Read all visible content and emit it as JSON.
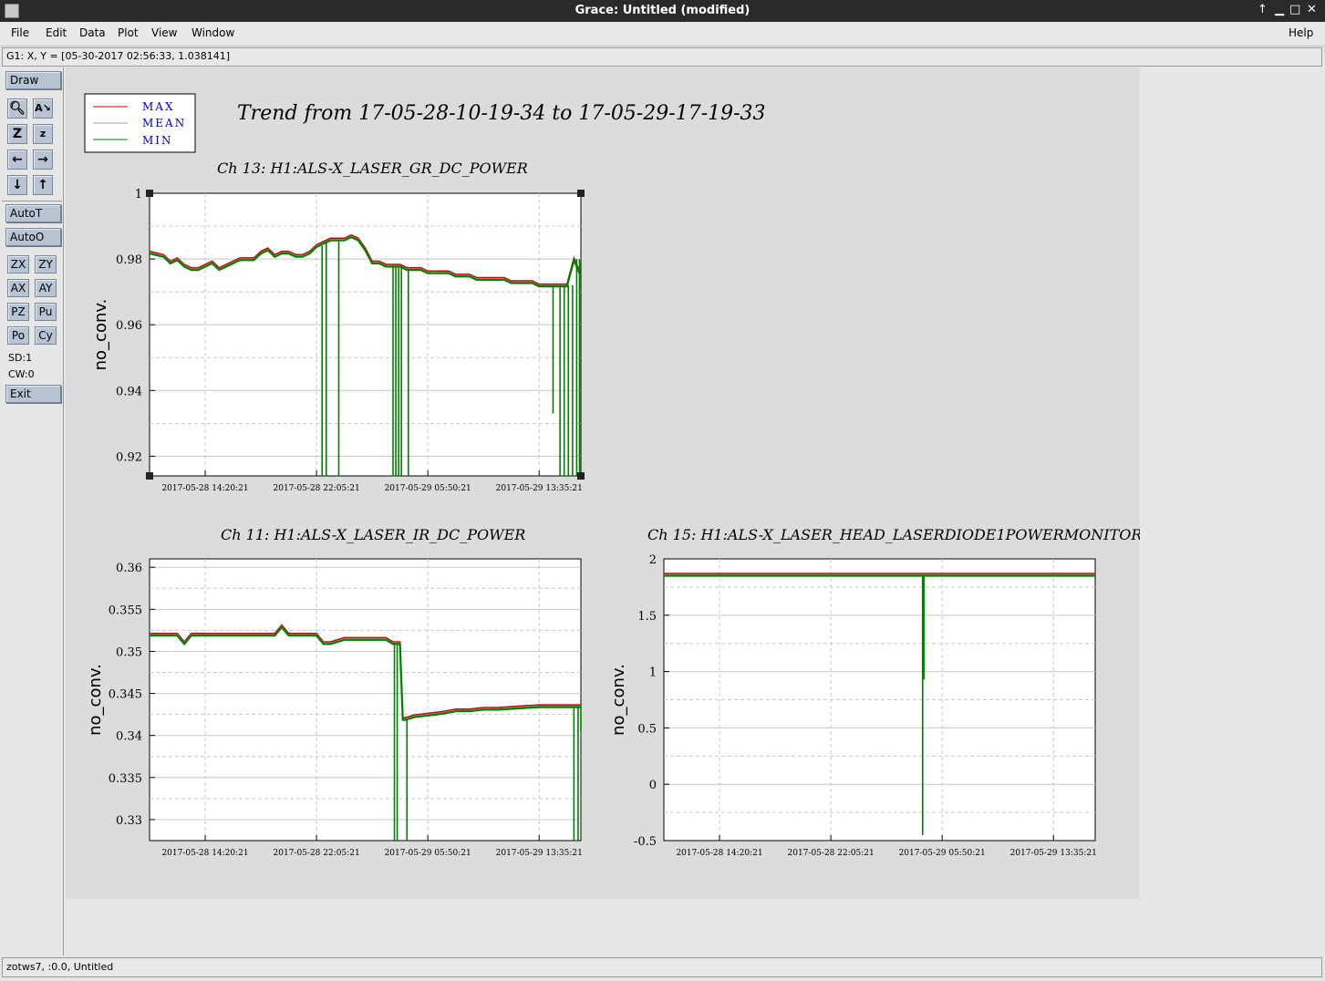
{
  "window": {
    "title": "Grace: Untitled (modified)",
    "controls": [
      "↑",
      "▁",
      "□",
      "✕"
    ]
  },
  "menu": {
    "file": "File",
    "edit": "Edit",
    "data": "Data",
    "plot": "Plot",
    "view": "View",
    "window": "Window",
    "help": "Help"
  },
  "locator": "G1: X, Y = [05-30-2017 02:56:33, 1.038141]",
  "toolbar": {
    "draw": "Draw",
    "autot": "AutoT",
    "autoo": "AutoO",
    "zx": "ZX",
    "zy": "ZY",
    "ax": "AX",
    "ay": "AY",
    "pz": "PZ",
    "pu": "Pu",
    "po": "Po",
    "cy": "Cy",
    "sd": "SD:1",
    "cw": "CW:0",
    "exit": "Exit",
    "icons": [
      "zoom-icon",
      "autoscale-icon",
      "zoom-in-icon",
      "zoom-out-icon",
      "arrow-left-icon",
      "arrow-right-icon",
      "arrow-down-icon",
      "arrow-up-icon"
    ]
  },
  "status": "zotws7, :0.0, Untitled",
  "canvas": {
    "main_title": "Trend from 17-05-28-10-19-34 to 17-05-29-17-19-33",
    "legend": [
      {
        "label": "MAX",
        "color": "#d00000"
      },
      {
        "label": "MEAN",
        "color": "#a0a0a0"
      },
      {
        "label": "MIN",
        "color": "#008000"
      }
    ]
  },
  "chart_data": [
    {
      "type": "line",
      "title": "Ch 13: H1:ALS-X_LASER_GR_DC_POWER",
      "ylabel": "no_conv.",
      "ylim": [
        0.914,
        1.0
      ],
      "yticks": [
        0.92,
        0.94,
        0.96,
        0.98,
        1
      ],
      "ytick_labels": [
        "0.92",
        "0.94",
        "0.96",
        "0.98",
        "1"
      ],
      "xlim": [
        0,
        31
      ],
      "xticks": [
        4,
        12,
        20,
        28
      ],
      "xtick_labels": [
        "2017-05-28 14:20:21",
        "2017-05-28 22:05:21",
        "2017-05-29 05:50:21",
        "2017-05-29 13:35:21"
      ],
      "series_x": [
        0,
        1,
        1.5,
        2,
        2.5,
        3,
        3.5,
        4,
        4.5,
        5,
        5.5,
        6,
        6.5,
        7,
        7.5,
        8,
        8.5,
        9,
        9.5,
        10,
        10.5,
        11,
        11.5,
        12,
        12.5,
        13,
        13.5,
        14,
        14.5,
        15,
        15.5,
        16,
        16.5,
        17,
        17.5,
        18,
        18.5,
        19,
        19.5,
        20,
        20.5,
        21,
        21.5,
        22,
        22.5,
        23,
        23.5,
        24,
        24.5,
        25,
        25.5,
        26,
        26.5,
        27,
        27.5,
        28,
        28.5,
        29,
        29.5,
        30,
        30.5,
        31
      ],
      "series_y": [
        0.982,
        0.981,
        0.979,
        0.98,
        0.978,
        0.977,
        0.977,
        0.978,
        0.979,
        0.977,
        0.978,
        0.979,
        0.98,
        0.98,
        0.98,
        0.982,
        0.983,
        0.981,
        0.982,
        0.982,
        0.981,
        0.981,
        0.982,
        0.984,
        0.985,
        0.986,
        0.986,
        0.986,
        0.987,
        0.986,
        0.983,
        0.979,
        0.979,
        0.978,
        0.978,
        0.978,
        0.977,
        0.977,
        0.977,
        0.976,
        0.976,
        0.976,
        0.976,
        0.975,
        0.975,
        0.975,
        0.974,
        0.974,
        0.974,
        0.974,
        0.974,
        0.973,
        0.973,
        0.973,
        0.973,
        0.972,
        0.972,
        0.972,
        0.972,
        0.972,
        0.98,
        0.975
      ],
      "dropouts": [
        [
          12.4,
          0.91
        ],
        [
          12.7,
          0.91
        ],
        [
          13.6,
          0.91
        ],
        [
          17.5,
          0.91
        ],
        [
          17.7,
          0.91
        ],
        [
          17.9,
          0.91
        ],
        [
          18.1,
          0.91
        ],
        [
          18.6,
          0.91
        ],
        [
          29.0,
          0.933
        ],
        [
          29.5,
          0.91
        ],
        [
          29.8,
          0.91
        ],
        [
          30.1,
          0.91
        ],
        [
          30.4,
          0.91
        ],
        [
          30.7,
          0.91
        ],
        [
          30.9,
          0.91
        ]
      ]
    },
    {
      "type": "line",
      "title": "Ch 11: H1:ALS-X_LASER_IR_DC_POWER",
      "ylabel": "no_conv.",
      "ylim": [
        0.3275,
        0.361
      ],
      "yticks": [
        0.33,
        0.335,
        0.34,
        0.345,
        0.35,
        0.355,
        0.36
      ],
      "ytick_labels": [
        "0.33",
        "0.335",
        "0.34",
        "0.345",
        "0.35",
        "0.355",
        "0.36"
      ],
      "xlim": [
        0,
        31
      ],
      "xticks": [
        4,
        12,
        20,
        28
      ],
      "xtick_labels": [
        "2017-05-28 14:20:21",
        "2017-05-28 22:05:21",
        "2017-05-29 05:50:21",
        "2017-05-29 13:35:21"
      ],
      "series_x": [
        0,
        1,
        2,
        2.5,
        3,
        4,
        5,
        6,
        7,
        8,
        9,
        9.5,
        10,
        11,
        12,
        12.5,
        13,
        14,
        15,
        16,
        17,
        17.5,
        18,
        18.2,
        18.4,
        19,
        20,
        21,
        22,
        23,
        24,
        25,
        26,
        27,
        28,
        29,
        30,
        31
      ],
      "series_y": [
        0.352,
        0.352,
        0.352,
        0.351,
        0.352,
        0.352,
        0.352,
        0.352,
        0.352,
        0.352,
        0.352,
        0.353,
        0.352,
        0.352,
        0.352,
        0.351,
        0.351,
        0.3515,
        0.3515,
        0.3515,
        0.3515,
        0.351,
        0.351,
        0.342,
        0.342,
        0.3423,
        0.3425,
        0.3427,
        0.343,
        0.343,
        0.3432,
        0.3432,
        0.3433,
        0.3434,
        0.3435,
        0.3435,
        0.3435,
        0.3435
      ],
      "dropouts": [
        [
          17.6,
          0.327
        ],
        [
          17.8,
          0.327
        ],
        [
          18.5,
          0.327
        ],
        [
          30.5,
          0.327
        ],
        [
          30.8,
          0.327
        ],
        [
          31.0,
          0.3405
        ]
      ]
    },
    {
      "type": "line",
      "title": "Ch 15: H1:ALS-X_LASER_HEAD_LASERDIODE1POWERMONITOR",
      "ylabel": "no_conv.",
      "ylim": [
        -0.5,
        2
      ],
      "yticks": [
        -0.5,
        0,
        0.5,
        1,
        1.5,
        2
      ],
      "ytick_labels": [
        "-0.5",
        "0",
        "0.5",
        "1",
        "1.5",
        "2"
      ],
      "xlim": [
        0,
        31
      ],
      "xticks": [
        4,
        12,
        20,
        28
      ],
      "xtick_labels": [
        "2017-05-28 14:20:21",
        "2017-05-28 22:05:21",
        "2017-05-29 05:50:21",
        "2017-05-29 13:35:21"
      ],
      "series_x": [
        0,
        31
      ],
      "series_y": [
        1.86,
        1.86
      ],
      "dropouts": [
        [
          18.6,
          -0.45
        ],
        [
          18.7,
          0.93
        ]
      ]
    }
  ]
}
